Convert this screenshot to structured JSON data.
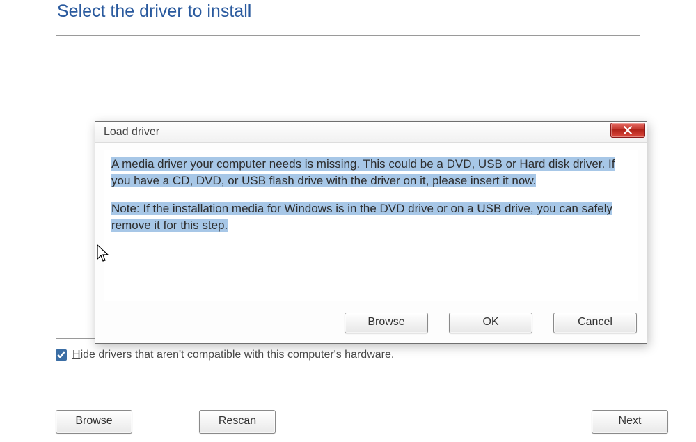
{
  "page": {
    "title": "Select the driver to install",
    "hide_checkbox_label_pre": "H",
    "hide_checkbox_label_rest": "ide drivers that aren't compatible with this computer's hardware.",
    "hide_checked": true,
    "buttons": {
      "browse_u": "r",
      "browse_pre": "B",
      "browse_post": "owse",
      "rescan_u": "R",
      "rescan_post": "escan",
      "next_u": "N",
      "next_post": "ext"
    }
  },
  "dialog": {
    "title": "Load driver",
    "message1": "A media driver your computer needs is missing. This could be a DVD, USB or Hard disk driver. If you have a CD, DVD, or USB flash drive with the driver on it, please insert it now.",
    "message2": "Note: If the installation media for Windows is in the DVD drive or on a USB drive, you can safely remove it for this step.",
    "buttons": {
      "browse_u": "B",
      "browse_post": "rowse",
      "ok": "OK",
      "cancel": "Cancel"
    }
  }
}
